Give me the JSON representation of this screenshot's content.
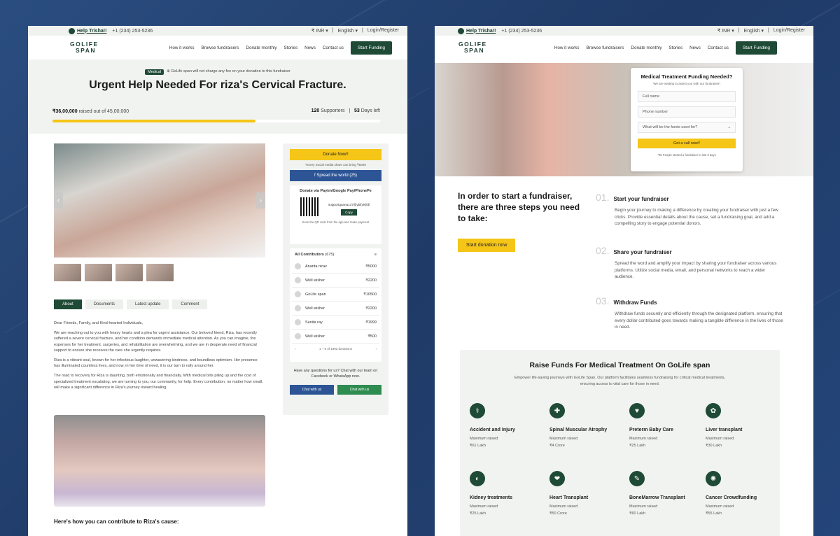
{
  "left": {
    "topbar": {
      "help": "Help Trisha!!",
      "phone": "+1 (234) 253-5236",
      "currency": "₹ INR",
      "language": "English",
      "login": "Login/Register"
    },
    "nav": {
      "logo_top": "GOLIFE",
      "logo_bottom": "SPAN",
      "links": [
        "How it works",
        "Browse fundraisers",
        "Donate monthly",
        "Stories",
        "News",
        "Contact us"
      ],
      "cta": "Start Funding"
    },
    "hero": {
      "badge": "Medical",
      "notice": "GoLife span will not charge any fee on your donation to this fundraiser",
      "title": "Urgent Help Needed For riza's Cervical Fracture.",
      "raised": "₹36,00,000",
      "raised_suffix": "raised out of 45,00,000",
      "supporters_count": "120",
      "supporters_label": "Supporters",
      "days_count": "53",
      "days_label": "Days left",
      "progress": 0.62
    },
    "tabs": [
      "About",
      "Documents",
      "Latest update",
      "Comment"
    ],
    "story": [
      "Dear Friends, Family, and Kind-hearted Individuals,",
      "We are reaching out to you with heavy hearts and a plea for urgent assistance. Our beloved friend, Riza, has recently suffered a severe cervical fracture, and her condition demands immediate medical attention. As you can imagine, the expenses for her treatment, surgeries, and rehabilitation are overwhelming, and we are in desperate need of financial support to ensure she receives the care she urgently requires.",
      "Riza is a vibrant soul, known for her infectious laughter, unwavering kindness, and boundless optimism. Her presence has illuminated countless lives, and now, in her time of need, it is our turn to rally around her.",
      "The road to recovery for Riza is daunting, both emotionally and financially. With medical bills piling up and the cost of specialized treatment escalating, we are turning to you, our community, for help. Every contribution, no matter how small, will make a significant difference in Riza's journey toward healing."
    ],
    "contribute_heading": "Here's how you can contribute to Riza's cause:",
    "sidebar": {
      "donate": "Donate Now!!",
      "share_note": "*Every Social media share can bring ₹5000",
      "spread": "Spread the world (25)",
      "upi_title": "Donate via Paytm/Google Pay/PhonePe",
      "upi_id": "supportgoana137@ybl(ok)fdl",
      "copy": "Copy",
      "scan_note": "Scan the QR code from the app and make payment",
      "contributors_title": "All Contributors",
      "contributors_count": "(675)",
      "contributors": [
        {
          "name": "Ananta nirav",
          "amount": "₹5000"
        },
        {
          "name": "Well wisher",
          "amount": "₹2200"
        },
        {
          "name": "GoLife span",
          "amount": "₹10500"
        },
        {
          "name": "Well wisher",
          "amount": "₹2200"
        },
        {
          "name": "Sunita ray",
          "amount": "₹1999"
        },
        {
          "name": "Well wisher",
          "amount": "₹500"
        }
      ],
      "pagination": "1 – 5 of 1392 donations",
      "questions": "Have any questions for us? Chat with our team on Facebook or WhatsApp now.",
      "chat_fb": "Chat with us",
      "chat_wa": "Chat with us"
    }
  },
  "right": {
    "topbar": {
      "help": "Help Trisha!!",
      "phone": "+1 (234) 253-5236",
      "currency": "₹ INR",
      "language": "English",
      "login": "Login/Register"
    },
    "nav": {
      "logo_top": "GOLIFE",
      "logo_bottom": "SPAN",
      "links": [
        "How it works",
        "Browse fundraisers",
        "Donate monthly",
        "Stories",
        "News",
        "Contact us"
      ],
      "cta": "Start Funding"
    },
    "form": {
      "title": "Medical Treatment Funding Needed?",
      "subtitle": "We are waiting to assist you with our fundraiser!",
      "name_placeholder": "Full name",
      "phone_placeholder": "Phone number",
      "select_placeholder": "What will be the funds used for?",
      "submit": "Get a call now!!",
      "footnote": "*38 People started a fundraiser in last 3 days"
    },
    "steps_heading": "In order to start a fundraiser, there are three steps you need to take:",
    "start_donation": "Start donation now",
    "steps": [
      {
        "num": "01.",
        "title": "Start your fundraiser",
        "desc": "Begin your journey to making a difference by creating your fundraiser with just a few clicks. Provide essential details about the cause, set a fundraising goal, and add a compelling story to engage potential donors."
      },
      {
        "num": "02.",
        "title": "Share your fundraiser",
        "desc": "Spread the word and amplify your impact by sharing your fundraiser across various platforms. Utilize social media, email, and personal networks to reach a wider audience."
      },
      {
        "num": "03.",
        "title": "Withdraw Funds",
        "desc": "Withdraw funds securely and efficiently through the designated platform, ensuring that every dollar contributed goes towards making a tangible difference in the lives of those in need."
      }
    ],
    "raise": {
      "title": "Raise Funds For Medical Treatment On GoLife span",
      "desc": "Empower life-saving journeys with GoLife Span. Our platform facilitates seamless fundraising for critical medical treatments, ensuring access to vital care for those in need.",
      "max_label": "Maximum raised",
      "categories": [
        {
          "name": "Accident and Injury",
          "value": "₹61 Lakh",
          "icon": "⚕"
        },
        {
          "name": "Spinal Muscular Atrophy",
          "value": "₹4 Crore",
          "icon": "✚"
        },
        {
          "name": "Preterm Baby Care",
          "value": "₹25 Lakh",
          "icon": "♥"
        },
        {
          "name": "Liver transplant",
          "value": "₹30 Lakh",
          "icon": "✿"
        },
        {
          "name": "Kidney treatments",
          "value": "₹25 Lakh",
          "icon": "◐"
        },
        {
          "name": "Heart Transplant",
          "value": "₹50 Crore",
          "icon": "❤"
        },
        {
          "name": "BoneMarrow Transplant",
          "value": "₹60 Lakh",
          "icon": "✎"
        },
        {
          "name": "Cancer Crowdfunding",
          "value": "₹55 Lakh",
          "icon": "✺"
        }
      ]
    }
  }
}
